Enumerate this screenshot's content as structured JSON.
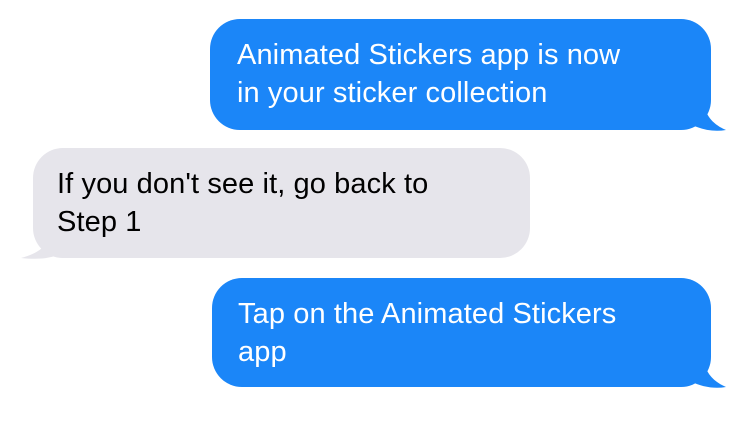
{
  "conversation": {
    "messages": [
      {
        "direction": "sent",
        "text": "Animated Stickers app is now\nin your sticker collection"
      },
      {
        "direction": "received",
        "text": "If you don't see it, go back to\nStep 1"
      },
      {
        "direction": "sent",
        "text": "Tap on the Animated Stickers\napp"
      }
    ]
  },
  "colors": {
    "sent_bubble": "#1b86f8",
    "sent_text": "#ffffff",
    "received_bubble": "#e6e5eb",
    "received_text": "#000000",
    "background": "#ffffff"
  }
}
